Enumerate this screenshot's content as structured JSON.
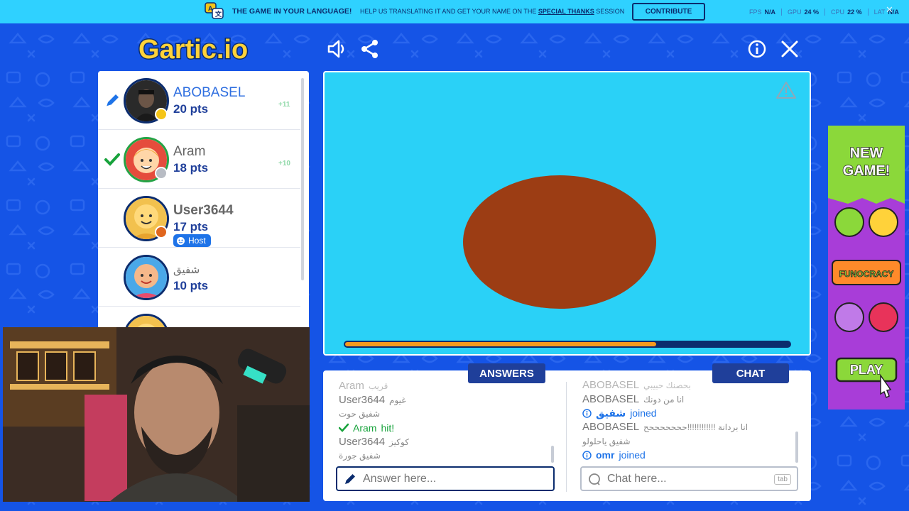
{
  "banner": {
    "promo": "THE GAME IN YOUR LANGUAGE!",
    "promo_sub_prefix": "HELP US TRANSLATING IT AND GET YOUR NAME ON THE",
    "promo_sub_link": "SPECIAL THANKS",
    "promo_sub_suffix": "SESSION",
    "contribute": "CONTRIBUTE",
    "stats": [
      {
        "label": "FPS",
        "value": "N/A"
      },
      {
        "label": "GPU",
        "value": "24 %"
      },
      {
        "label": "CPU",
        "value": "22 %"
      },
      {
        "label": "LAT",
        "value": "N/A"
      }
    ]
  },
  "logo": "Gartic.io",
  "players": [
    {
      "name": "ABOBASEL",
      "points": "20 pts",
      "gain": "+11",
      "status": "pencil-icon",
      "dot": "#f5c518",
      "me": true
    },
    {
      "name": "Aram",
      "points": "18 pts",
      "gain": "+10",
      "status": "check-icon",
      "dot": "#b8bcc4",
      "me": false
    },
    {
      "name": "User3644",
      "points": "17 pts",
      "gain": "",
      "status": "",
      "dot": "#e0661e",
      "me": false,
      "host": "Host"
    },
    {
      "name": "شفيق",
      "points": "10 pts",
      "gain": "",
      "status": "",
      "dot": "",
      "me": false
    }
  ],
  "canvas": {
    "bg": "#2ad1f7",
    "shape_color": "#9c3d14",
    "timer_progress": 0.7
  },
  "answers": {
    "title": "ANSWERS",
    "messages": [
      {
        "user": "Aram",
        "text": "قريب",
        "type": "msg",
        "faded": true
      },
      {
        "user": "User3644",
        "text": "غيوم",
        "type": "msg"
      },
      {
        "user": "",
        "text": "شفيق حوت",
        "type": "text"
      },
      {
        "user": "Aram",
        "text": "hit!",
        "type": "hit"
      },
      {
        "user": "User3644",
        "text": "كوكيز",
        "type": "msg"
      },
      {
        "user": "",
        "text": "شفيق جورة",
        "type": "text"
      }
    ],
    "placeholder": "Answer here..."
  },
  "chat": {
    "title": "CHAT",
    "messages": [
      {
        "user": "ABOBASEL",
        "text": "بحصنك حبيبي",
        "type": "msg",
        "faded": true
      },
      {
        "user": "ABOBASEL",
        "text": "انا من دونك",
        "type": "msg"
      },
      {
        "user": "شفيق",
        "text": "joined",
        "type": "join"
      },
      {
        "user": "ABOBASEL",
        "text": "انا بردانة !!!!!!!!!!!!حححححححح",
        "type": "msg"
      },
      {
        "user": "",
        "text": "شفيق ياحلولو",
        "type": "text"
      },
      {
        "user": "omr",
        "text": "joined",
        "type": "join"
      }
    ],
    "placeholder": "Chat here...",
    "tab_hint": "tab"
  },
  "ad": {
    "line1": "NEW",
    "line2": "GAME!",
    "brand": "FUNOCRACY",
    "play": "PLAY"
  }
}
